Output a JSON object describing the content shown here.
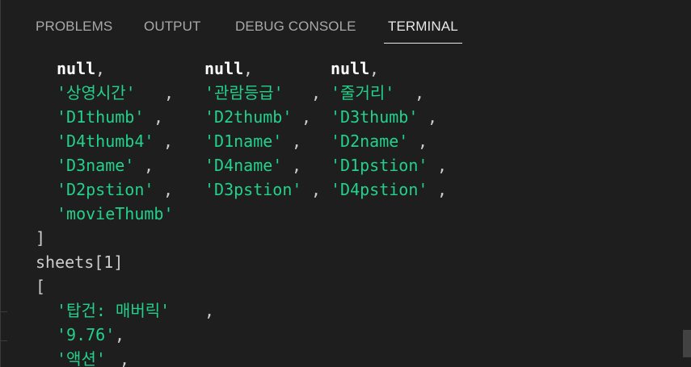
{
  "tabs": [
    {
      "label": "PROBLEMS",
      "active": false
    },
    {
      "label": "OUTPUT",
      "active": false
    },
    {
      "label": "DEBUG CONSOLE",
      "active": false
    },
    {
      "label": "TERMINAL",
      "active": true
    }
  ],
  "terminal": {
    "lines": [
      [
        {
          "t": "null",
          "c": "null"
        },
        {
          "t": ",",
          "c": "punct"
        },
        {
          "t": "null",
          "c": "null"
        },
        {
          "t": ",",
          "c": "punct"
        },
        {
          "t": "null",
          "c": "null"
        },
        {
          "t": ",",
          "c": "punct"
        }
      ],
      [
        {
          "t": "'상영시간'",
          "c": "str"
        },
        {
          "t": ",",
          "c": "punct"
        },
        {
          "t": "'관람등급'",
          "c": "str"
        },
        {
          "t": ",",
          "c": "punct"
        },
        {
          "t": "'줄거리'",
          "c": "str"
        },
        {
          "t": ",",
          "c": "punct"
        }
      ],
      [
        {
          "t": "'D1thumb'",
          "c": "str"
        },
        {
          "t": ",",
          "c": "punct"
        },
        {
          "t": "'D2thumb'",
          "c": "str"
        },
        {
          "t": ",",
          "c": "punct"
        },
        {
          "t": "'D3thumb'",
          "c": "str"
        },
        {
          "t": ",",
          "c": "punct"
        }
      ],
      [
        {
          "t": "'D4thumb4'",
          "c": "str"
        },
        {
          "t": ",",
          "c": "punct"
        },
        {
          "t": "'D1name'",
          "c": "str"
        },
        {
          "t": ",",
          "c": "punct"
        },
        {
          "t": "'D2name'",
          "c": "str"
        },
        {
          "t": ",",
          "c": "punct"
        }
      ],
      [
        {
          "t": "'D3name'",
          "c": "str"
        },
        {
          "t": ",",
          "c": "punct"
        },
        {
          "t": "'D4name'",
          "c": "str"
        },
        {
          "t": ",",
          "c": "punct"
        },
        {
          "t": "'D1pstion'",
          "c": "str"
        },
        {
          "t": ",",
          "c": "punct"
        }
      ],
      [
        {
          "t": "'D2pstion'",
          "c": "str"
        },
        {
          "t": ",",
          "c": "punct"
        },
        {
          "t": "'D3pstion'",
          "c": "str"
        },
        {
          "t": ",",
          "c": "punct"
        },
        {
          "t": "'D4pstion'",
          "c": "str"
        },
        {
          "t": ",",
          "c": "punct"
        }
      ],
      [
        {
          "t": "'movieThumb'",
          "c": "str"
        }
      ],
      [
        {
          "t": "]",
          "c": "plain"
        }
      ],
      [
        {
          "t": "sheets[1]",
          "c": "plain"
        }
      ],
      [
        {
          "t": "[",
          "c": "plain"
        }
      ],
      [
        {
          "t": "'탑건: 매버릭'",
          "c": "str"
        },
        {
          "t": ",",
          "c": "punct"
        }
      ],
      [
        {
          "t": "'9.76'",
          "c": "str"
        },
        {
          "t": ",",
          "c": "punct"
        }
      ],
      [
        {
          "t": "'액션'",
          "c": "str"
        },
        {
          "t": ",",
          "c": "punct"
        }
      ]
    ]
  },
  "colors": {
    "background": "#1e1e1e",
    "string": "#23d18b",
    "keyword_null": "#ffffff",
    "text": "#cccccc",
    "tab_inactive": "#a8a8a8",
    "tab_active": "#e7e7e7"
  }
}
